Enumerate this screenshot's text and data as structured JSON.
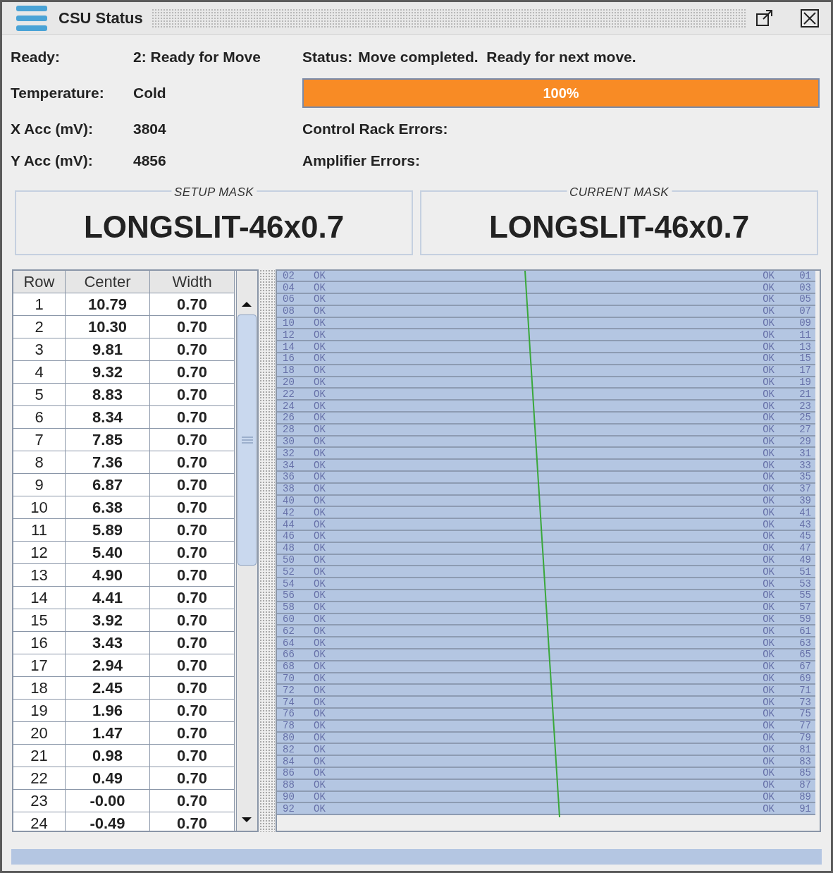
{
  "window": {
    "title": "CSU Status"
  },
  "info": {
    "ready_label": "Ready:",
    "ready_value": "2: Ready for Move",
    "temperature_label": "Temperature:",
    "temperature_value": "Cold",
    "x_acc_label": "X Acc (mV):",
    "x_acc_value": "3804",
    "y_acc_label": "Y Acc (mV):",
    "y_acc_value": "4856",
    "status_label": "Status:",
    "status_value": "Move completed.  Ready for next move.",
    "control_rack_errors_label": "Control Rack Errors:",
    "amplifier_errors_label": "Amplifier Errors:"
  },
  "progress": {
    "level": 1,
    "text": "100%"
  },
  "setup_mask": {
    "title": "SETUP MASK",
    "value": "LONGSLIT-46x0.7"
  },
  "current_mask": {
    "title": "CURRENT MASK",
    "value": "LONGSLIT-46x0.7"
  },
  "table": {
    "columns": [
      "Row",
      "Center",
      "Width"
    ],
    "rows": [
      [
        "1",
        "10.79",
        "0.70"
      ],
      [
        "2",
        "10.30",
        "0.70"
      ],
      [
        "3",
        "9.81",
        "0.70"
      ],
      [
        "4",
        "9.32",
        "0.70"
      ],
      [
        "5",
        "8.83",
        "0.70"
      ],
      [
        "6",
        "8.34",
        "0.70"
      ],
      [
        "7",
        "7.85",
        "0.70"
      ],
      [
        "8",
        "7.36",
        "0.70"
      ],
      [
        "9",
        "6.87",
        "0.70"
      ],
      [
        "10",
        "6.38",
        "0.70"
      ],
      [
        "11",
        "5.89",
        "0.70"
      ],
      [
        "12",
        "5.40",
        "0.70"
      ],
      [
        "13",
        "4.90",
        "0.70"
      ],
      [
        "14",
        "4.41",
        "0.70"
      ],
      [
        "15",
        "3.92",
        "0.70"
      ],
      [
        "16",
        "3.43",
        "0.70"
      ],
      [
        "17",
        "2.94",
        "0.70"
      ],
      [
        "18",
        "2.45",
        "0.70"
      ],
      [
        "19",
        "1.96",
        "0.70"
      ],
      [
        "20",
        "1.47",
        "0.70"
      ],
      [
        "21",
        "0.98",
        "0.70"
      ],
      [
        "22",
        "0.49",
        "0.70"
      ],
      [
        "23",
        "-0.00",
        "0.70"
      ],
      [
        "24",
        "-0.49",
        "0.70"
      ]
    ]
  },
  "slit_bars": [
    {
      "left_number": "02",
      "left_status": "OK",
      "right_status": "OK",
      "right_number": "01"
    },
    {
      "left_number": "04",
      "left_status": "OK",
      "right_status": "OK",
      "right_number": "03"
    },
    {
      "left_number": "06",
      "left_status": "OK",
      "right_status": "OK",
      "right_number": "05"
    },
    {
      "left_number": "08",
      "left_status": "OK",
      "right_status": "OK",
      "right_number": "07"
    },
    {
      "left_number": "10",
      "left_status": "OK",
      "right_status": "OK",
      "right_number": "09"
    },
    {
      "left_number": "12",
      "left_status": "OK",
      "right_status": "OK",
      "right_number": "11"
    },
    {
      "left_number": "14",
      "left_status": "OK",
      "right_status": "OK",
      "right_number": "13"
    },
    {
      "left_number": "16",
      "left_status": "OK",
      "right_status": "OK",
      "right_number": "15"
    },
    {
      "left_number": "18",
      "left_status": "OK",
      "right_status": "OK",
      "right_number": "17"
    },
    {
      "left_number": "20",
      "left_status": "OK",
      "right_status": "OK",
      "right_number": "19"
    },
    {
      "left_number": "22",
      "left_status": "OK",
      "right_status": "OK",
      "right_number": "21"
    },
    {
      "left_number": "24",
      "left_status": "OK",
      "right_status": "OK",
      "right_number": "23"
    },
    {
      "left_number": "26",
      "left_status": "OK",
      "right_status": "OK",
      "right_number": "25"
    },
    {
      "left_number": "28",
      "left_status": "OK",
      "right_status": "OK",
      "right_number": "27"
    },
    {
      "left_number": "30",
      "left_status": "OK",
      "right_status": "OK",
      "right_number": "29"
    },
    {
      "left_number": "32",
      "left_status": "OK",
      "right_status": "OK",
      "right_number": "31"
    },
    {
      "left_number": "34",
      "left_status": "OK",
      "right_status": "OK",
      "right_number": "33"
    },
    {
      "left_number": "36",
      "left_status": "OK",
      "right_status": "OK",
      "right_number": "35"
    },
    {
      "left_number": "38",
      "left_status": "OK",
      "right_status": "OK",
      "right_number": "37"
    },
    {
      "left_number": "40",
      "left_status": "OK",
      "right_status": "OK",
      "right_number": "39"
    },
    {
      "left_number": "42",
      "left_status": "OK",
      "right_status": "OK",
      "right_number": "41"
    },
    {
      "left_number": "44",
      "left_status": "OK",
      "right_status": "OK",
      "right_number": "43"
    },
    {
      "left_number": "46",
      "left_status": "OK",
      "right_status": "OK",
      "right_number": "45"
    },
    {
      "left_number": "48",
      "left_status": "OK",
      "right_status": "OK",
      "right_number": "47"
    },
    {
      "left_number": "50",
      "left_status": "OK",
      "right_status": "OK",
      "right_number": "49"
    },
    {
      "left_number": "52",
      "left_status": "OK",
      "right_status": "OK",
      "right_number": "51"
    },
    {
      "left_number": "54",
      "left_status": "OK",
      "right_status": "OK",
      "right_number": "53"
    },
    {
      "left_number": "56",
      "left_status": "OK",
      "right_status": "OK",
      "right_number": "55"
    },
    {
      "left_number": "58",
      "left_status": "OK",
      "right_status": "OK",
      "right_number": "57"
    },
    {
      "left_number": "60",
      "left_status": "OK",
      "right_status": "OK",
      "right_number": "59"
    },
    {
      "left_number": "62",
      "left_status": "OK",
      "right_status": "OK",
      "right_number": "61"
    },
    {
      "left_number": "64",
      "left_status": "OK",
      "right_status": "OK",
      "right_number": "63"
    },
    {
      "left_number": "66",
      "left_status": "OK",
      "right_status": "OK",
      "right_number": "65"
    },
    {
      "left_number": "68",
      "left_status": "OK",
      "right_status": "OK",
      "right_number": "67"
    },
    {
      "left_number": "70",
      "left_status": "OK",
      "right_status": "OK",
      "right_number": "69"
    },
    {
      "left_number": "72",
      "left_status": "OK",
      "right_status": "OK",
      "right_number": "71"
    },
    {
      "left_number": "74",
      "left_status": "OK",
      "right_status": "OK",
      "right_number": "73"
    },
    {
      "left_number": "76",
      "left_status": "OK",
      "right_status": "OK",
      "right_number": "75"
    },
    {
      "left_number": "78",
      "left_status": "OK",
      "right_status": "OK",
      "right_number": "77"
    },
    {
      "left_number": "80",
      "left_status": "OK",
      "right_status": "OK",
      "right_number": "79"
    },
    {
      "left_number": "82",
      "left_status": "OK",
      "right_status": "OK",
      "right_number": "81"
    },
    {
      "left_number": "84",
      "left_status": "OK",
      "right_status": "OK",
      "right_number": "83"
    },
    {
      "left_number": "86",
      "left_status": "OK",
      "right_status": "OK",
      "right_number": "85"
    },
    {
      "left_number": "88",
      "left_status": "OK",
      "right_status": "OK",
      "right_number": "87"
    },
    {
      "left_number": "90",
      "left_status": "OK",
      "right_status": "OK",
      "right_number": "89"
    },
    {
      "left_number": "92",
      "left_status": "OK",
      "right_status": "OK",
      "right_number": "91"
    }
  ]
}
